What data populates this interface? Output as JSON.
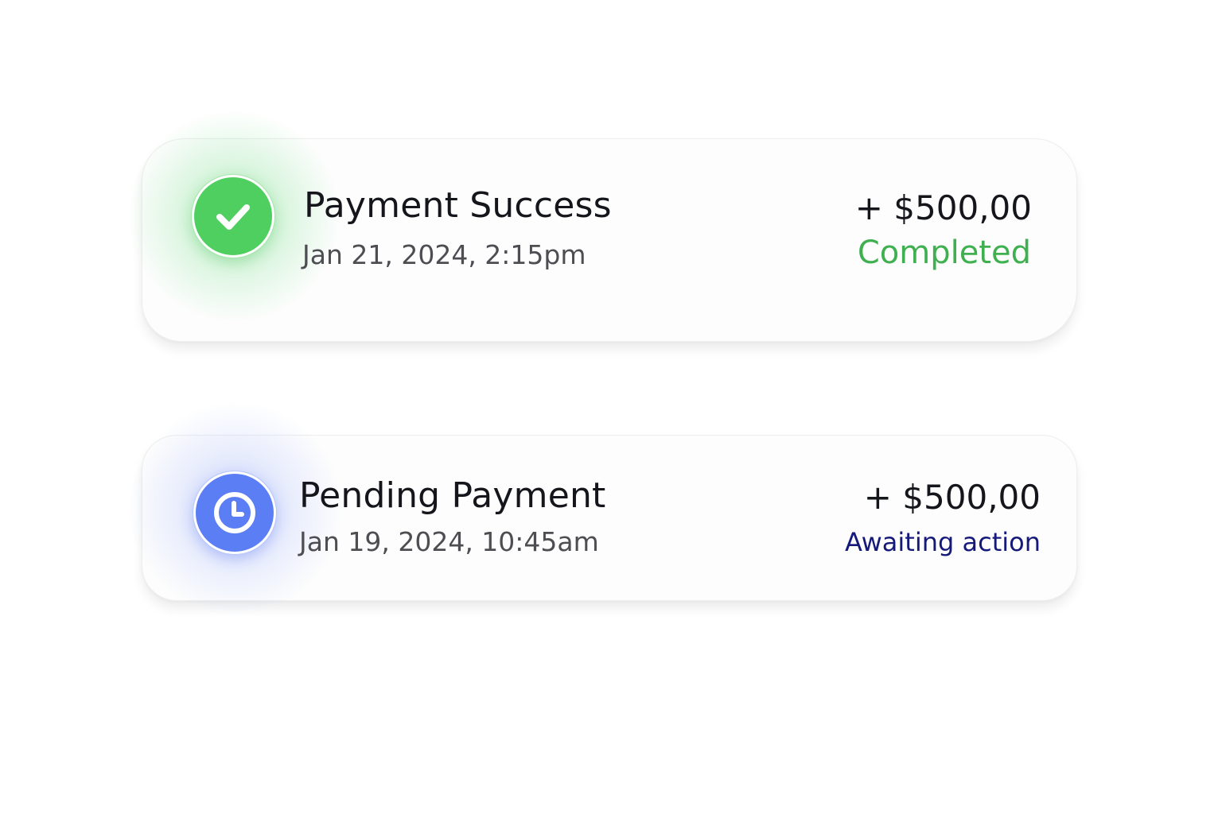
{
  "colors": {
    "success": "#3fb04f",
    "pending": "#151a7a",
    "success_icon_bg": "#4fcf5f",
    "pending_icon_bg": "#5b7ef4",
    "text_primary": "#15161c",
    "text_secondary": "#4d4d52"
  },
  "transactions": [
    {
      "icon": "check-icon",
      "title": "Payment Success",
      "datetime": "Jan 21, 2024, 2:15pm",
      "amount": "+ $500,00",
      "status": "Completed",
      "status_color": "#3fb04f"
    },
    {
      "icon": "clock-icon",
      "title": "Pending Payment",
      "datetime": "Jan 19, 2024, 10:45am",
      "amount": "+ $500,00",
      "status": "Awaiting action",
      "status_color": "#151a7a"
    }
  ]
}
